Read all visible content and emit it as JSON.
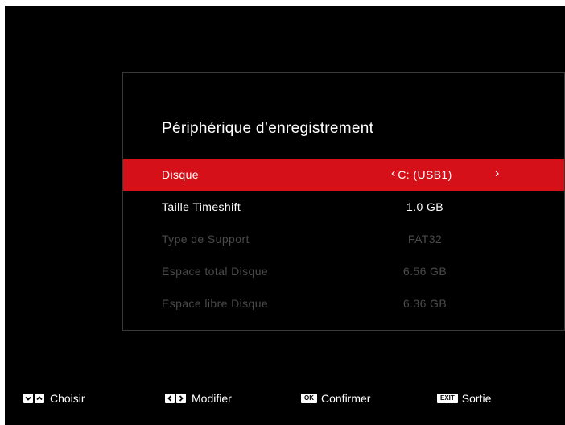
{
  "panel": {
    "title": "Périphérique d’enregistrement",
    "rows": [
      {
        "label": "Disque",
        "value": "C: (USB1)",
        "selected": true,
        "enabled": true
      },
      {
        "label": "Taille Timeshift",
        "value": "1.0 GB",
        "selected": false,
        "enabled": true
      },
      {
        "label": "Type de Support",
        "value": "FAT32",
        "selected": false,
        "enabled": false
      },
      {
        "label": "Espace total Disque",
        "value": "6.56 GB",
        "selected": false,
        "enabled": false
      },
      {
        "label": "Espace libre Disque",
        "value": "6.36 GB",
        "selected": false,
        "enabled": false
      }
    ],
    "arrow_left": "‹",
    "arrow_right": "›"
  },
  "footer": {
    "choose_label": "Choisir",
    "modify_label": "Modifier",
    "ok_key": "OK",
    "confirm_label": "Confirmer",
    "exit_key": "EXIT",
    "exit_label": "Sortie"
  },
  "colors": {
    "selection": "#d61019",
    "background": "#000000",
    "disabled_text": "#4a4a4a"
  }
}
